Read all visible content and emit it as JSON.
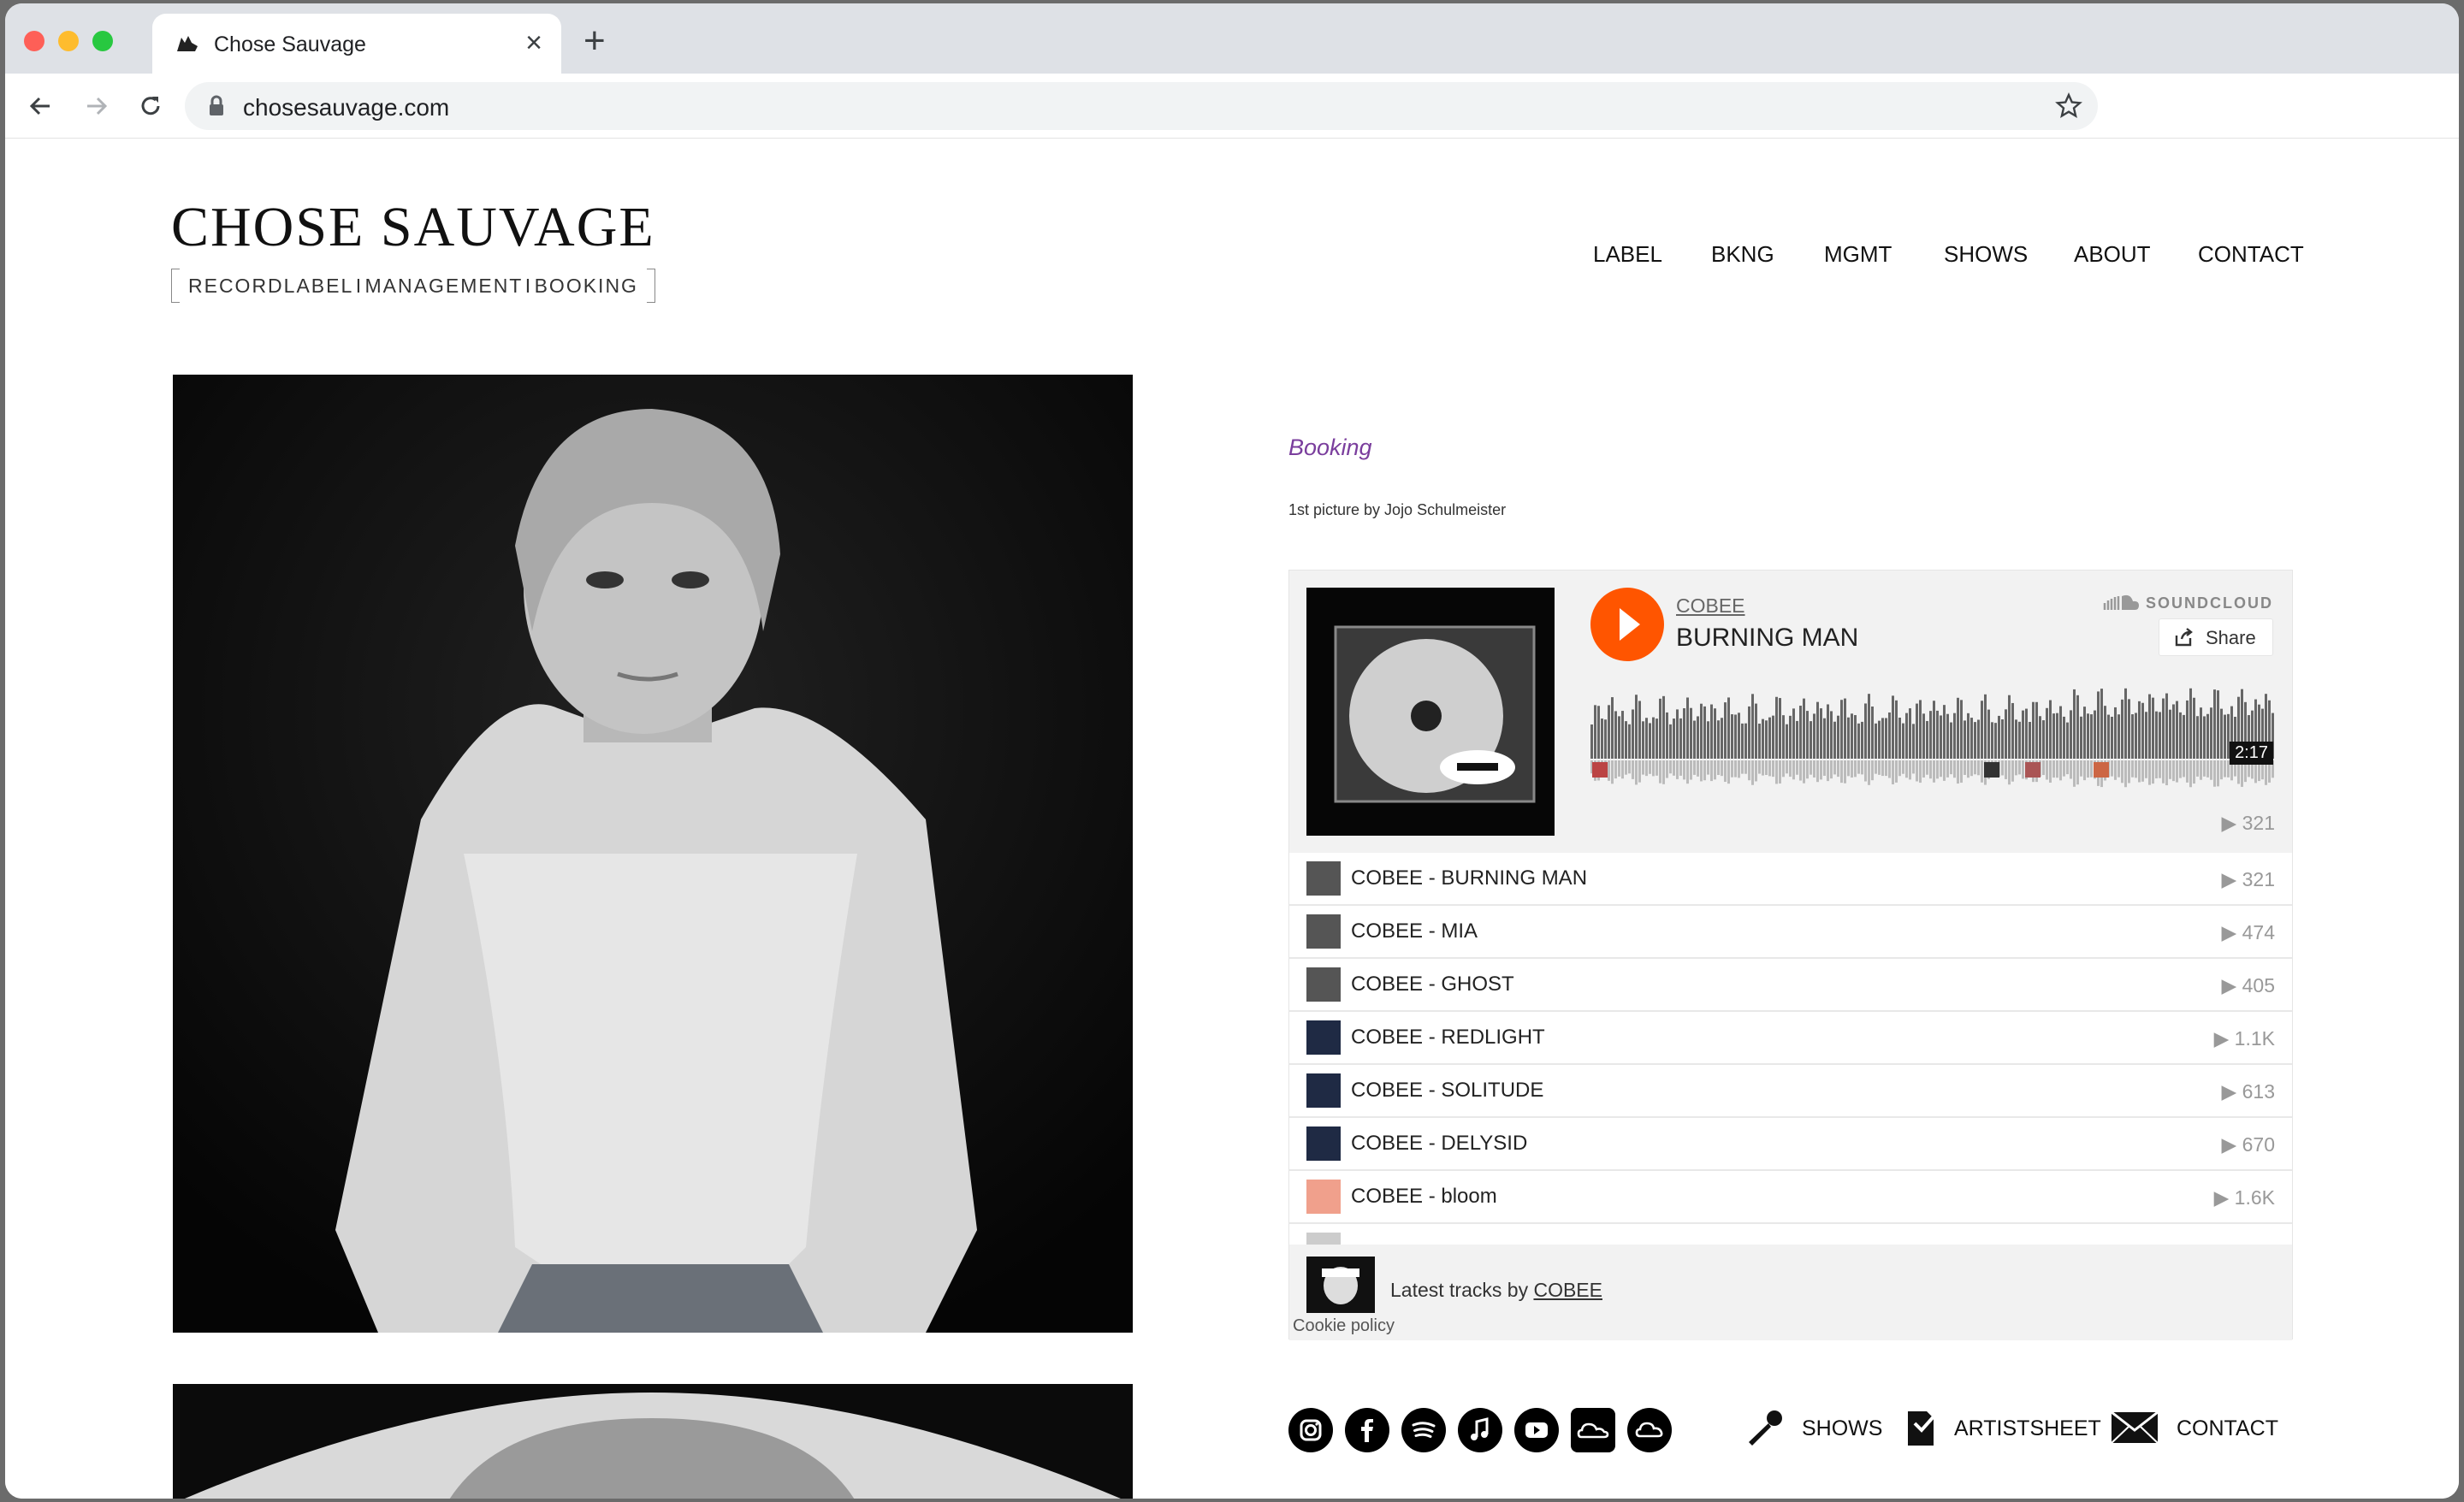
{
  "browser": {
    "tab_title": "Chose Sauvage",
    "url": "chosesauvage.com",
    "new_tab": "+",
    "close": "×"
  },
  "site": {
    "logo_title": "CHOSE  SAUVAGE",
    "logo_sub": [
      "RECORDLABEL",
      "I",
      "MANAGEMENT",
      "I",
      "BOOKING"
    ],
    "nav": [
      "LABEL",
      "BKNG",
      "MGMT",
      "SHOWS",
      "ABOUT",
      "CONTACT"
    ]
  },
  "content": {
    "booking_link": "Booking",
    "photo_credit": "1st picture by Jojo Schulmeister"
  },
  "soundcloud": {
    "artist": "COBEE",
    "track": "BURNING MAN",
    "brand": "SOUNDCLOUD",
    "share": "Share",
    "duration": "2:17",
    "plays": "321",
    "tracks": [
      {
        "title": "COBEE - BURNING MAN",
        "plays": "321",
        "thumb": "gray"
      },
      {
        "title": "COBEE - MIA",
        "plays": "474",
        "thumb": "gray"
      },
      {
        "title": "COBEE - GHOST",
        "plays": "405",
        "thumb": "gray"
      },
      {
        "title": "COBEE - REDLIGHT",
        "plays": "1.1K",
        "thumb": "navy"
      },
      {
        "title": "COBEE - SOLITUDE",
        "plays": "613",
        "thumb": "navy"
      },
      {
        "title": "COBEE - DELYSID",
        "plays": "670",
        "thumb": "navy"
      },
      {
        "title": "COBEE - bloom",
        "plays": "1.6K",
        "thumb": "peach"
      }
    ],
    "latest_prefix": "Latest tracks by ",
    "latest_artist": "COBEE",
    "cookie": "Cookie policy"
  },
  "footer": {
    "social_icons": [
      "instagram-icon",
      "facebook-icon",
      "spotify-icon",
      "apple-music-icon",
      "youtube-icon",
      "soundcloud-icon",
      "cloud-icon"
    ],
    "links": [
      "SHOWS",
      "ARTISTSHEET",
      "CONTACT"
    ]
  },
  "colors": {
    "accent_purple": "#7a3e9d",
    "soundcloud_orange": "#ff5500",
    "tabbar": "#dee1e6"
  }
}
